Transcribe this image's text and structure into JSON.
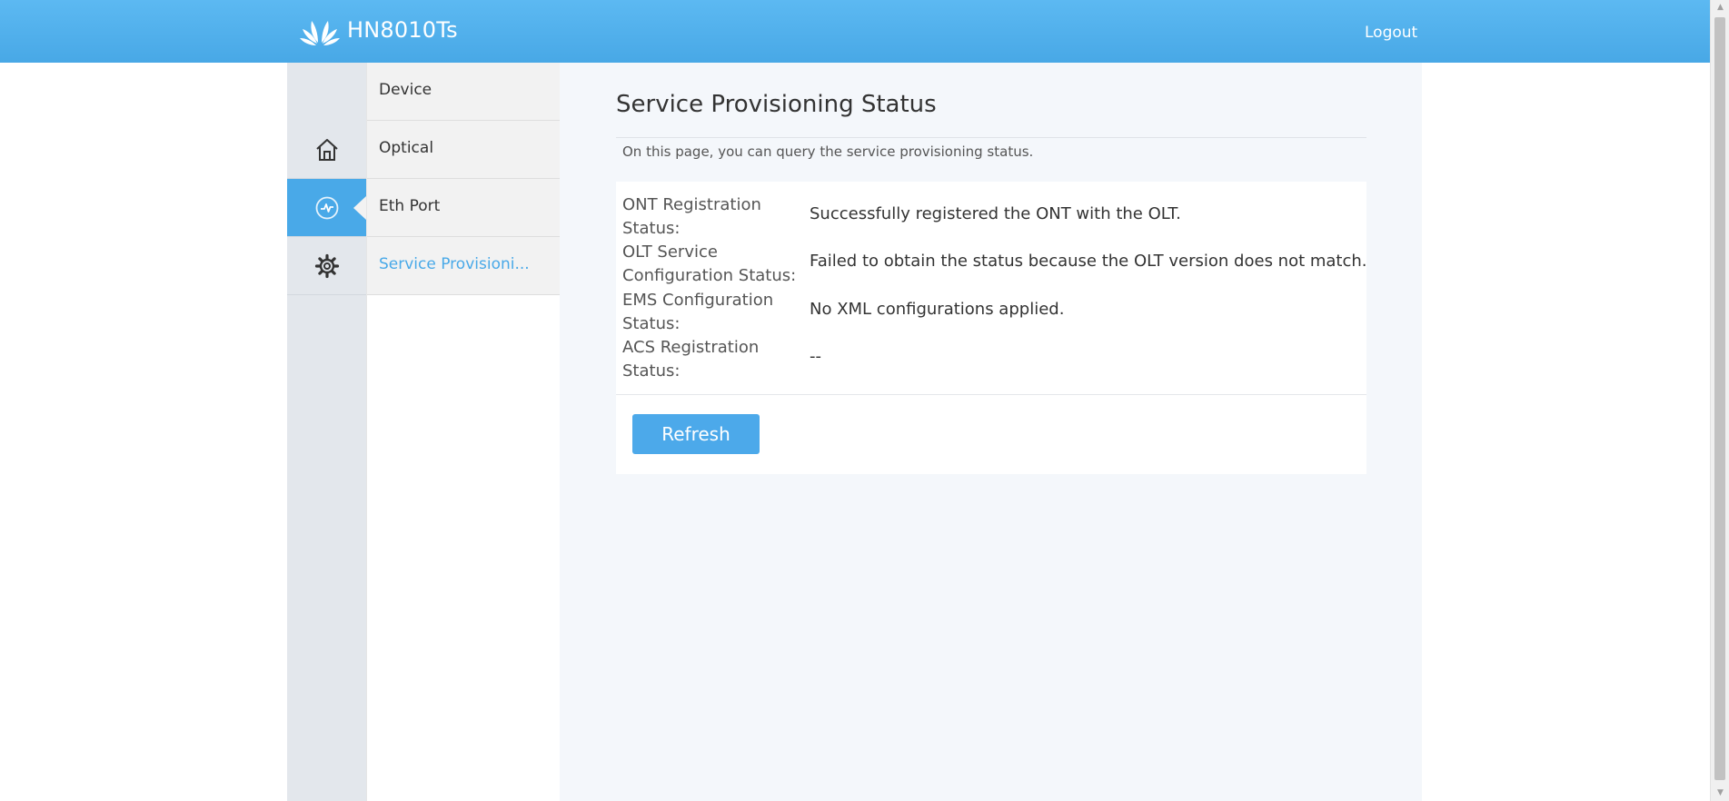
{
  "header": {
    "brand": "HN8010Ts",
    "logout_label": "Logout",
    "accent_color": "#49a9e8"
  },
  "iconbar": {
    "items": [
      {
        "icon": "home-icon"
      },
      {
        "icon": "status-icon",
        "active": true
      },
      {
        "icon": "gear-icon"
      }
    ]
  },
  "submenu": {
    "items": [
      {
        "label": "Device"
      },
      {
        "label": "Optical"
      },
      {
        "label": "Eth Port"
      },
      {
        "label": "Service Provisioni...",
        "selected": true
      }
    ]
  },
  "main": {
    "title": "Service Provisioning Status",
    "description": "On this page, you can query the service provisioning status.",
    "rows": [
      {
        "label": "ONT Registration Status:",
        "value": "Successfully registered the ONT with the OLT."
      },
      {
        "label": "OLT Service Configuration Status:",
        "value": "Failed to obtain the status because the OLT version does not match."
      },
      {
        "label": "EMS Configuration Status:",
        "value": "No XML configurations applied."
      },
      {
        "label": "ACS Registration Status:",
        "value": "--"
      }
    ],
    "refresh_label": "Refresh"
  }
}
